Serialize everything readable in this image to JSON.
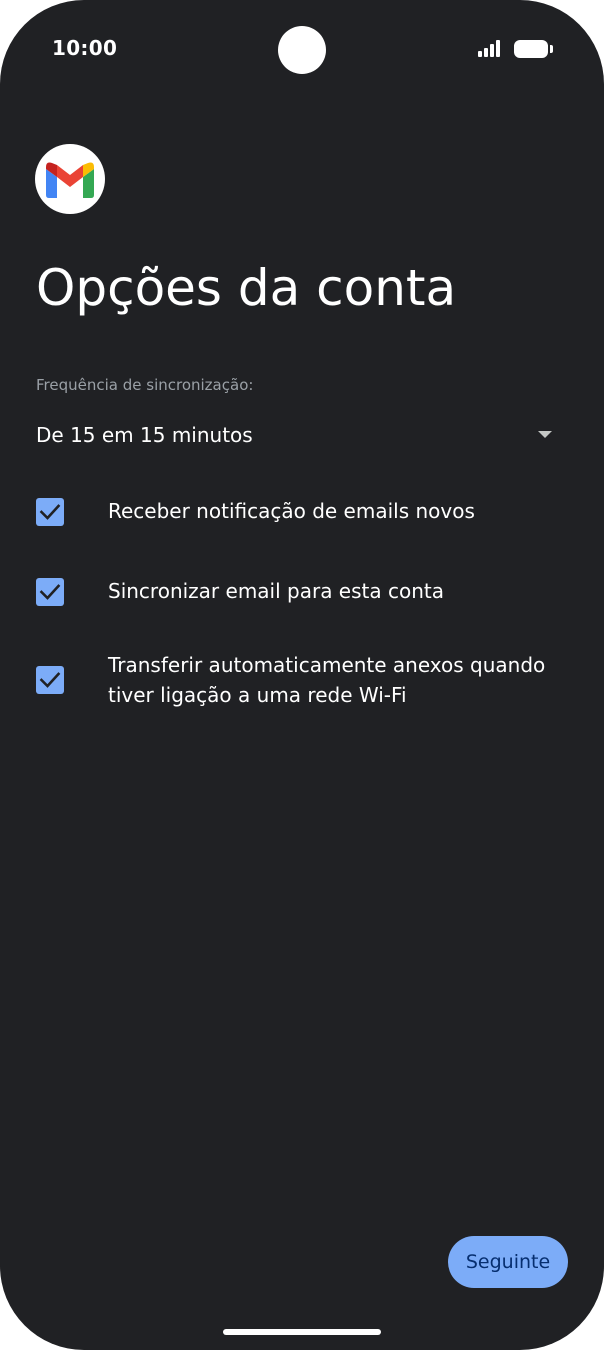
{
  "status_bar": {
    "time": "10:00",
    "icons": [
      "signal-icon",
      "battery-icon"
    ]
  },
  "app": {
    "logo_icon": "gmail-logo-icon",
    "brand_colors": {
      "red": "#ea4335",
      "blue": "#4285f4",
      "green": "#34a853",
      "yellow": "#fbbc04"
    }
  },
  "page": {
    "title": "Opções da conta"
  },
  "sync": {
    "label": "Frequência de sincronização:",
    "selected": "De 15 em 15 minutos"
  },
  "options": [
    {
      "label": "Receber notificação de emails novos",
      "checked": true
    },
    {
      "label": "Sincronizar email para esta conta",
      "checked": true
    },
    {
      "label": "Transferir automaticamente anexos quando tiver ligação a uma rede Wi-Fi",
      "checked": true
    }
  ],
  "actions": {
    "next_label": "Seguinte"
  },
  "colors": {
    "background": "#202124",
    "accent": "#7cacf8",
    "text": "#ffffff",
    "secondary_text": "#9aa0a6"
  }
}
